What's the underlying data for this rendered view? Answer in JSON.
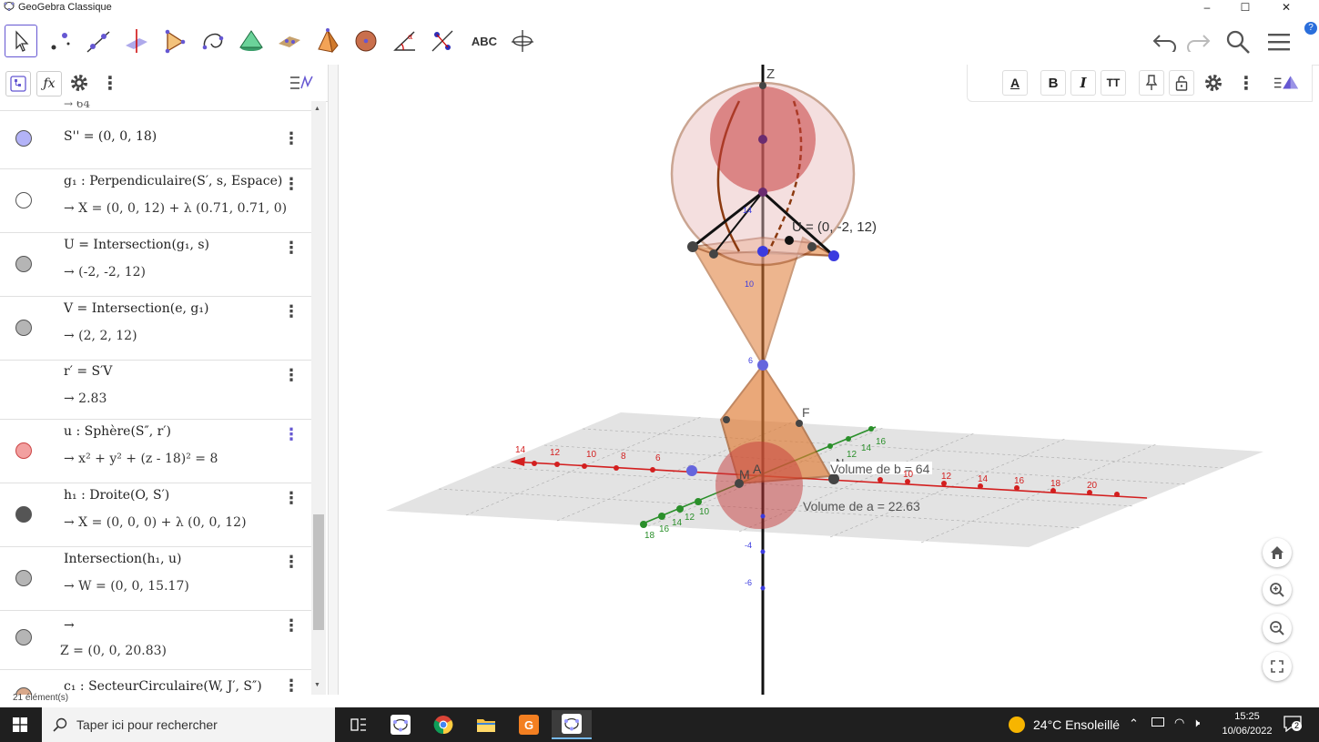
{
  "window": {
    "title": "GeoGebra Classique",
    "controls": [
      "–",
      "☐",
      "✕"
    ]
  },
  "toolbar": {
    "tools": [
      "move-tool",
      "point-tool",
      "line-tool",
      "perpendicular-tool",
      "polygon-tool",
      "circle-tool",
      "sphere-cone-tool",
      "plane-tool",
      "pyramid-tool",
      "sphere-tool",
      "angle-tool",
      "reflect-tool",
      "text-tool",
      "rotate-view-tool"
    ],
    "text_tool_label": "ABC",
    "right": [
      "undo-icon",
      "redo-icon",
      "search-icon",
      "menu-icon"
    ]
  },
  "algebra": {
    "partial_top": "→ 64",
    "rows": [
      {
        "line1": "S'' = (0, 0, 18)",
        "line2": "",
        "dot": "#b3b3f7"
      },
      {
        "line1": "g₁ : Perpendiculaire(S′, s, Espace)",
        "line2": "→ X = (0, 0, 12) + λ (0.71, 0.71, 0)",
        "dot": "#ffffff"
      },
      {
        "line1": "U = Intersection(g₁, s)",
        "line2": "→ (-2, -2, 12)",
        "dot": "#b5b5b5"
      },
      {
        "line1": "V = Intersection(e, g₁)",
        "line2": "→ (2, 2, 12)",
        "dot": "#b5b5b5"
      },
      {
        "line1": "r′ = S′V",
        "line2": "→ 2.83",
        "dot": ""
      },
      {
        "line1": "u : Sphère(S″, r′)",
        "line2": "→ x² + y² + (z - 18)² = 8",
        "dot": "#f2a0a0"
      },
      {
        "line1": "h₁ : Droite(O, S′)",
        "line2": "→ X = (0, 0, 0) + λ (0, 0, 12)",
        "dot": "#555555"
      },
      {
        "line1": "Intersection(h₁, u)",
        "line2": "→ W = (0, 0, 15.17)",
        "dot": "#b5b5b5"
      },
      {
        "line1": "→",
        "line2": "Z = (0, 0, 20.83)",
        "dot": "#b5b5b5"
      },
      {
        "line1": "c₁ : SecteurCirculaire(W, J′, S″)",
        "line2": "",
        "dot": "#d9a88a"
      }
    ]
  },
  "status": "21 élément(s)",
  "view3d": {
    "labels": {
      "z_axis": "Z",
      "volume_b": "Volume de b = 64",
      "volume_a": "Volume de a = 22.63",
      "point_f": "F",
      "point_m": "M",
      "point_a": "A",
      "point_n": "N",
      "coord_label": "U = (0, -2, 12)",
      "z_ticks": [
        "14",
        "10",
        "6",
        "-4",
        "-6"
      ],
      "x_ticks_left": [
        "14",
        "12",
        "10",
        "8",
        "6"
      ],
      "y_ticks": [
        "18",
        "16",
        "14",
        "12",
        "10"
      ],
      "y_ticks_back": [
        "16",
        "14",
        "12"
      ],
      "x_ticks_right": [
        "10",
        "12",
        "14",
        "16",
        "18",
        "20"
      ]
    }
  },
  "stylebar": {
    "buttons": [
      "text-color",
      "bold",
      "italic",
      "text-size",
      "pin",
      "lock",
      "settings",
      "more",
      "view-toggle"
    ],
    "bold": "B",
    "italic": "I",
    "size": "TT"
  },
  "taskbar": {
    "search_placeholder": "Taper ici pour rechercher",
    "weather": "24°C Ensoleillé",
    "time": "15:25",
    "date": "10/06/2022",
    "notifications": "2"
  }
}
